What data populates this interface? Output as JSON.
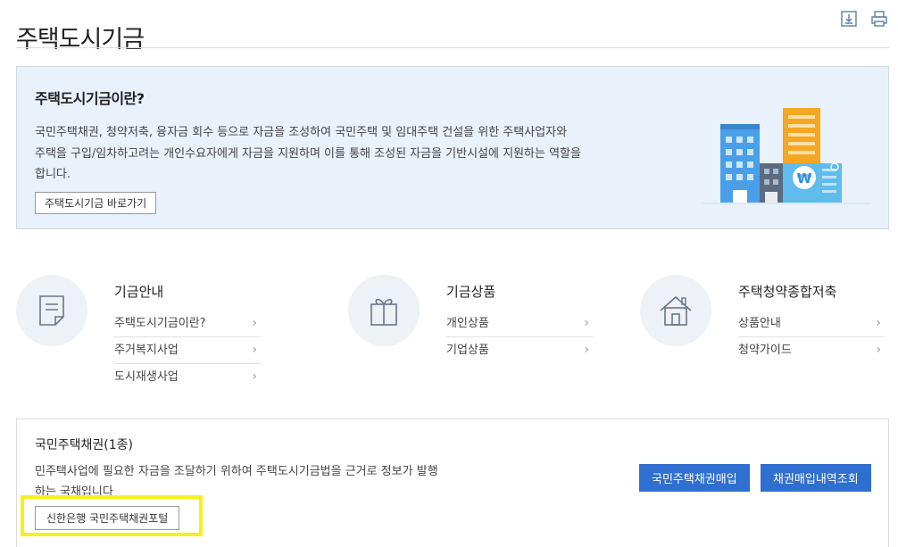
{
  "page": {
    "title": "주택도시기금"
  },
  "icons": {
    "download": "download-icon",
    "print": "print-icon"
  },
  "intro": {
    "heading": "주택도시기금이란?",
    "lines": [
      "국민주택채권, 청약저축, 융자금 회수 등으로 자금을 조성하여 국민주택 및 임대주택 건설을 위한 주택사업자와",
      "주택을 구입/임차하고려는 개인수요자에게 자금을 지원하며 이를 통해 조성된 자금을 기반시설에 지원하는 역할을",
      "합니다."
    ],
    "button": "주택도시기금 바로가기",
    "illustration": "city-buildings-illustration"
  },
  "categories": [
    {
      "title": "기금안내",
      "icon": "memo-icon",
      "items": [
        {
          "label": "주택도시기금이란?"
        },
        {
          "label": "주거복지사업"
        },
        {
          "label": "도시재생사업"
        }
      ]
    },
    {
      "title": "기금상품",
      "icon": "gift-box-icon",
      "items": [
        {
          "label": "개인상품"
        },
        {
          "label": "기업상품"
        }
      ]
    },
    {
      "title": "주택청약종합저축",
      "icon": "house-icon",
      "items": [
        {
          "label": "상품안내"
        },
        {
          "label": "청약가이드"
        }
      ]
    }
  ],
  "bond": {
    "title": "국민주택채권(1종)",
    "lines": [
      "민주택사업에 필요한 자금을 조달하기 위하여 주택도시기금법을 근거로 정보가 발행",
      "하는 국채입니다"
    ],
    "portal_button": "신한은행 국민주택채권포털",
    "buy_button": "국민주택채권매입",
    "history_button": "채권매입내역조회"
  },
  "colors": {
    "accent_blue": "#2f6fcf",
    "intro_bg": "#e9f1fb",
    "highlight": "#f6f01c"
  }
}
